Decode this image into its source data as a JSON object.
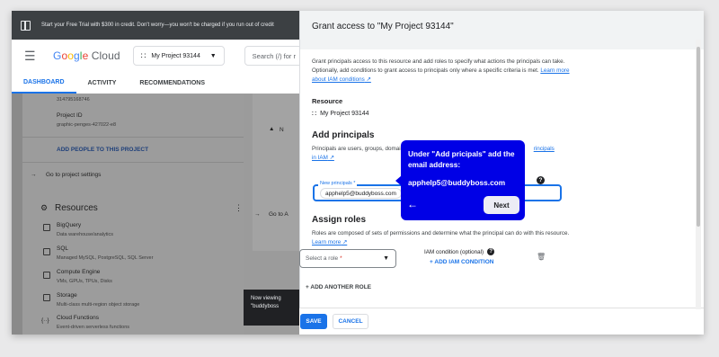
{
  "banner": {
    "text": "Start your Free Trial with $300 in credit. Don't worry—you won't be charged if you run out of credit"
  },
  "header": {
    "logo": {
      "g1": "G",
      "g2": "o",
      "g3": "o",
      "g4": "g",
      "g5": "l",
      "g6": "e",
      "cloud": " Cloud"
    },
    "project": "My Project 93144",
    "search_placeholder": "Search (/) for r"
  },
  "tabs": [
    {
      "label": "DASHBOARD",
      "active": true
    },
    {
      "label": "ACTIVITY"
    },
    {
      "label": "RECOMMENDATIONS"
    }
  ],
  "left": {
    "project_number": "314795168746",
    "project_id_label": "Project ID",
    "project_id": "graphic-penges-427022-e8",
    "add_people": "ADD PEOPLE TO THIS PROJECT",
    "goto_settings": "Go to project settings",
    "resources_title": "Resources",
    "resources": [
      {
        "name": "BigQuery",
        "desc": "Data warehouse/analytics",
        "icon": "bigquery-icon"
      },
      {
        "name": "SQL",
        "desc": "Managed MySQL, PostgreSQL, SQL Server",
        "icon": "sql-icon"
      },
      {
        "name": "Compute Engine",
        "desc": "VMs, GPUs, TPUs, Disks",
        "icon": "compute-engine-icon"
      },
      {
        "name": "Storage",
        "desc": "Multi-class multi-region object storage",
        "icon": "storage-icon"
      },
      {
        "name": "Cloud Functions",
        "desc": "Event-driven serverless functions",
        "icon": "cloud-functions-icon"
      },
      {
        "name": "Cloud Run",
        "desc": "",
        "icon": "cloud-run-icon"
      }
    ],
    "mid_na": "N",
    "mid_goto": "Go to A",
    "toast": "Now viewing \"buddyboss"
  },
  "dialog": {
    "title": "Grant access to \"My Project 93144\"",
    "intro": "Grant principals access to this resource and add roles to specify what actions the principals can take. Optionally, add conditions to grant access to principals only where a specific criteria is met.",
    "intro_link": "Learn more about IAM conditions",
    "resource_heading": "Resource",
    "resource_value": "My Project 93144",
    "add_principals_heading": "Add principals",
    "principals_desc": "Principals are users, groups, domai",
    "principals_link_tail": "rincipals",
    "principals_link2": "in IAM",
    "field_label": "New principals *",
    "chip_value": "apphelp5@buddyboss.com",
    "assign_roles_heading": "Assign roles",
    "roles_desc": "Roles are composed of sets of permissions and determine what the principal can do with this resource.",
    "roles_link": "Learn more",
    "select_role_placeholder": "Select a role",
    "select_role_required": "*",
    "iam_condition_label": "IAM condition (optional)",
    "add_iam_condition": "ADD IAM CONDITION",
    "add_another_role": "ADD ANOTHER ROLE",
    "save": "SAVE",
    "cancel": "CANCEL"
  },
  "tooltip": {
    "title": "Under \"Add pricipals\" add the email address:",
    "email": "apphelp5@buddyboss.com",
    "next": "Next"
  },
  "colors": {
    "accent": "#1a73e8",
    "tooltip_bg": "#0000e6",
    "banner_bg": "#3c4043"
  }
}
